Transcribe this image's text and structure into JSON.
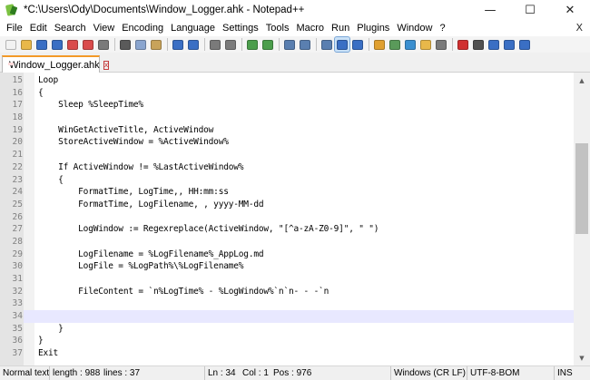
{
  "window": {
    "title": "*C:\\Users\\Ody\\Documents\\Window_Logger.ahk - Notepad++",
    "minimize_glyph": "—",
    "maximize_glyph": "☐",
    "close_glyph": "✕"
  },
  "menu": {
    "items": [
      "File",
      "Edit",
      "Search",
      "View",
      "Encoding",
      "Language",
      "Settings",
      "Tools",
      "Macro",
      "Run",
      "Plugins",
      "Window",
      "?"
    ],
    "close_glyph": "X"
  },
  "toolbar": {
    "buttons": [
      {
        "icon": "new-file-icon",
        "color": "#f2f2f2"
      },
      {
        "icon": "open-file-icon",
        "color": "#e8b84a"
      },
      {
        "icon": "save-icon",
        "color": "#3a6fc4"
      },
      {
        "icon": "save-all-icon",
        "color": "#3a6fc4"
      },
      {
        "icon": "close-file-icon",
        "color": "#d94b4b"
      },
      {
        "icon": "close-all-icon",
        "color": "#d94b4b"
      },
      {
        "icon": "print-icon",
        "color": "#7a7a7a"
      },
      {
        "icon": "cut-icon",
        "color": "#5a5a5a"
      },
      {
        "icon": "copy-icon",
        "color": "#8aa5cf"
      },
      {
        "icon": "paste-icon",
        "color": "#c8a35a"
      },
      {
        "icon": "undo-icon",
        "color": "#3a6fc4"
      },
      {
        "icon": "redo-icon",
        "color": "#3a6fc4"
      },
      {
        "icon": "find-icon",
        "color": "#7a7a7a"
      },
      {
        "icon": "replace-icon",
        "color": "#7a7a7a"
      },
      {
        "icon": "zoom-in-icon",
        "color": "#4c9e4c"
      },
      {
        "icon": "zoom-out-icon",
        "color": "#4c9e4c"
      },
      {
        "icon": "sync-vertical-icon",
        "color": "#5a7fb0"
      },
      {
        "icon": "sync-horizontal-icon",
        "color": "#5a7fb0"
      },
      {
        "icon": "word-wrap-icon",
        "color": "#5a7fb0"
      },
      {
        "icon": "show-all-characters-icon",
        "color": "#3a6fc4"
      },
      {
        "icon": "indent-guide-icon",
        "color": "#3a6fc4"
      },
      {
        "icon": "language-icon",
        "color": "#e0a030"
      },
      {
        "icon": "document-map-icon",
        "color": "#5a9a5a"
      },
      {
        "icon": "function-list-icon",
        "color": "#3a8fd0"
      },
      {
        "icon": "folder-workspace-icon",
        "color": "#e8b84a"
      },
      {
        "icon": "monitoring-icon",
        "color": "#7a7a7a"
      },
      {
        "icon": "start-recording-icon",
        "color": "#d03030"
      },
      {
        "icon": "stop-recording-icon",
        "color": "#505050"
      },
      {
        "icon": "playback-icon",
        "color": "#3a6fc4"
      },
      {
        "icon": "run-macro-multiple-icon",
        "color": "#3a6fc4"
      },
      {
        "icon": "save-macro-icon",
        "color": "#3a6fc4"
      }
    ]
  },
  "tab": {
    "label": "Window_Logger.ahk",
    "close_glyph": "x"
  },
  "editor": {
    "current_line": 34,
    "lines": [
      {
        "num": "15",
        "text": "Loop"
      },
      {
        "num": "16",
        "text": "{"
      },
      {
        "num": "17",
        "text": "    Sleep %SleepTime%"
      },
      {
        "num": "18",
        "text": ""
      },
      {
        "num": "19",
        "text": "    WinGetActiveTitle, ActiveWindow"
      },
      {
        "num": "20",
        "text": "    StoreActiveWindow = %ActiveWindow%"
      },
      {
        "num": "21",
        "text": ""
      },
      {
        "num": "22",
        "text": "    If ActiveWindow != %LastActiveWindow%"
      },
      {
        "num": "23",
        "text": "    {"
      },
      {
        "num": "24",
        "text": "        FormatTime, LogTime,, HH:mm:ss"
      },
      {
        "num": "25",
        "text": "        FormatTime, LogFilename, , yyyy-MM-dd"
      },
      {
        "num": "26",
        "text": ""
      },
      {
        "num": "27",
        "text": "        LogWindow := Regexreplace(ActiveWindow, \"[^a-zA-Z0-9]\", \" \")"
      },
      {
        "num": "28",
        "text": ""
      },
      {
        "num": "29",
        "text": "        LogFilename = %LogFilename%_AppLog.md"
      },
      {
        "num": "30",
        "text": "        LogFile = %LogPath%\\%LogFilename%"
      },
      {
        "num": "31",
        "text": ""
      },
      {
        "num": "32",
        "text": "        FileContent = `n%LogTime% - %LogWindow%`n`n- - -`n"
      },
      {
        "num": "33",
        "text": ""
      },
      {
        "num": "34",
        "text": ""
      },
      {
        "num": "35",
        "text": "    }"
      },
      {
        "num": "36",
        "text": "}"
      },
      {
        "num": "37",
        "text": "Exit"
      }
    ]
  },
  "status": {
    "type": "Normal text",
    "length": "length : 988",
    "lines": "lines : 37",
    "ln": "Ln : 34",
    "col": "Col : 1",
    "pos": "Pos : 976",
    "eol": "Windows (CR LF)",
    "encoding": "UTF-8-BOM",
    "mode": "INS"
  }
}
